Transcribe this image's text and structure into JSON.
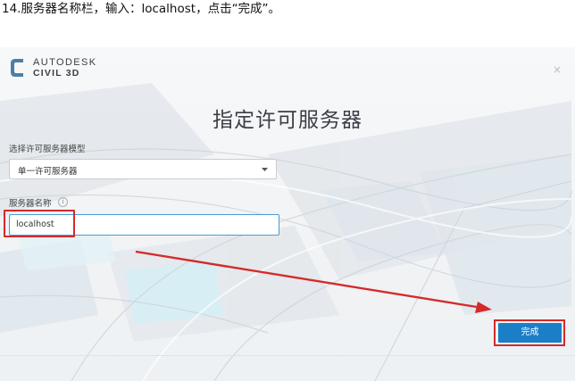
{
  "caption": "14.服务器名称栏，输入：localhost，点击“完成”。",
  "dialog": {
    "brand": {
      "line1": "AUTODESK",
      "line2": "CIVIL 3D",
      "logo_icon": "civil3d-c-logo"
    },
    "close_label": "×",
    "title": "指定许可服务器",
    "model_label": "选择许可服务器模型",
    "model_value": "单一许可服务器",
    "server_label": "服务器名称",
    "server_value": "localhost",
    "info_icon": "i",
    "finish_label": "完成"
  },
  "colors": {
    "accent_blue": "#1b7fc8",
    "highlight_red": "#d42a2a",
    "input_focus": "#4a9bd6"
  }
}
